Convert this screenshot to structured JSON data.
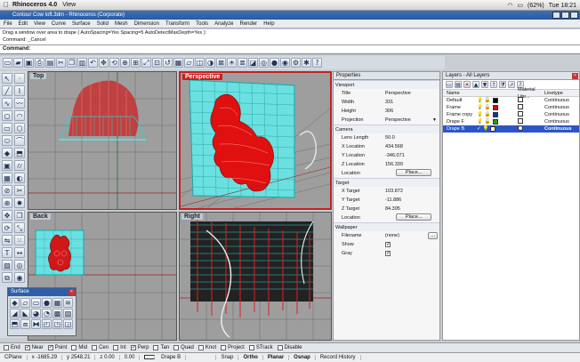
{
  "mac_menu": {
    "app": "Rhinoceros 4.0",
    "items": [
      "View"
    ],
    "right": [
      "(62%)",
      "Tue 18:21"
    ]
  },
  "window_title": "Contour Cow loft.3dm - Rhinoceros (Corporate)",
  "menu": [
    "File",
    "Edit",
    "View",
    "Curve",
    "Surface",
    "Solid",
    "Mesh",
    "Dimension",
    "Transform",
    "Tools",
    "Analyze",
    "Render",
    "Help"
  ],
  "history": {
    "line1": "Drag a window over area to drape ( AutoSpacing=Yes  Spacing=5  AutoDetectMaxDepth=Yes ):",
    "line2": "Command: _Cancel"
  },
  "command": {
    "label": "Command:",
    "value": ""
  },
  "viewports": {
    "top": "Top",
    "perspective": "Perspective",
    "back": "Back",
    "right": "Right"
  },
  "properties": {
    "title": "Properties",
    "section_viewport": "Viewport",
    "rows_vp": [
      {
        "k": "Title",
        "v": "Perspective"
      },
      {
        "k": "Width",
        "v": "331"
      },
      {
        "k": "Height",
        "v": "306"
      },
      {
        "k": "Projection",
        "v": "Perspective"
      }
    ],
    "section_camera": "Camera",
    "rows_cam": [
      {
        "k": "Lens Length",
        "v": "50.0"
      },
      {
        "k": "X Location",
        "v": "434.568"
      },
      {
        "k": "Y Location",
        "v": "-346.071"
      },
      {
        "k": "Z Location",
        "v": "156.339"
      }
    ],
    "cam_loc_label": "Location",
    "place_btn": "Place...",
    "section_target": "Target",
    "rows_tgt": [
      {
        "k": "X Target",
        "v": "103.872"
      },
      {
        "k": "Y Target",
        "v": "-11.886"
      },
      {
        "k": "Z Target",
        "v": "84.395"
      }
    ],
    "tgt_loc_label": "Location",
    "place_btn2": "Place...",
    "section_wallpaper": "Wallpaper",
    "filename_label": "Filename",
    "filename_value": "(none)",
    "filename_btn": "...",
    "show_label": "Show",
    "gray_label": "Gray"
  },
  "layers": {
    "title": "Layers - All Layers",
    "col_name": "Name",
    "col_mat": "Material Libr...",
    "col_lt": "Linetype",
    "rows": [
      {
        "name": "Default",
        "color": "#000000",
        "lt": "Continuous"
      },
      {
        "name": "Frame",
        "color": "#d01010",
        "lt": "Continuous"
      },
      {
        "name": "Frame copy",
        "color": "#1030c0",
        "lt": "Continuous"
      },
      {
        "name": "Drape F",
        "color": "#20a020",
        "lt": "Continuous"
      },
      {
        "name": "Drape B",
        "color": "#ffffff",
        "lt": "Continuous"
      }
    ]
  },
  "surface_palette": {
    "title": "Surface"
  },
  "osnaps": [
    "End",
    "Near",
    "Point",
    "Mid",
    "Cen",
    "Int",
    "Perp",
    "Tan",
    "Quad",
    "Knot",
    "Project",
    "STrack",
    "Disable"
  ],
  "osnap_checked": [
    false,
    true,
    true,
    false,
    false,
    false,
    true,
    false,
    false,
    false,
    false,
    false,
    false
  ],
  "status": {
    "cplane": "CPlane",
    "x": "x -1685.29",
    "y": "y 2548.21",
    "z": "z 0.00",
    "unit": "0.00",
    "layer": "Drape B",
    "snap": "Snap",
    "ortho": "Ortho",
    "planar": "Planar",
    "osnap": "Osnap",
    "rec": "Record History"
  }
}
